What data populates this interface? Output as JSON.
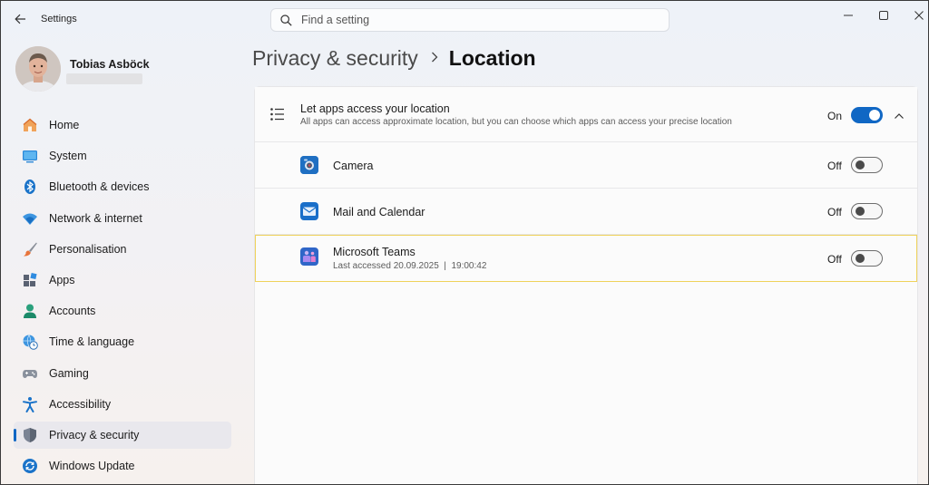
{
  "window": {
    "title": "Settings",
    "search_placeholder": "Find a setting"
  },
  "profile": {
    "name": "Tobias Asböck"
  },
  "nav": {
    "items": [
      {
        "label": "Home",
        "icon": "home-icon"
      },
      {
        "label": "System",
        "icon": "monitor-icon"
      },
      {
        "label": "Bluetooth & devices",
        "icon": "bluetooth-icon"
      },
      {
        "label": "Network & internet",
        "icon": "wifi-icon"
      },
      {
        "label": "Personalisation",
        "icon": "brush-icon"
      },
      {
        "label": "Apps",
        "icon": "apps-icon"
      },
      {
        "label": "Accounts",
        "icon": "person-icon"
      },
      {
        "label": "Time & language",
        "icon": "globe-clock-icon"
      },
      {
        "label": "Gaming",
        "icon": "gamepad-icon"
      },
      {
        "label": "Accessibility",
        "icon": "accessibility-icon"
      },
      {
        "label": "Privacy & security",
        "icon": "shield-icon",
        "active": true
      },
      {
        "label": "Windows Update",
        "icon": "update-icon"
      }
    ]
  },
  "breadcrumb": {
    "parent": "Privacy & security",
    "current": "Location"
  },
  "location": {
    "main": {
      "title": "Let apps access your location",
      "subtitle": "All apps can access approximate location, but you can choose which apps can access your precise location",
      "state": "On"
    },
    "apps": [
      {
        "name": "Camera",
        "state": "Off",
        "icon": "camera-icon"
      },
      {
        "name": "Mail and Calendar",
        "state": "Off",
        "icon": "mail-icon"
      },
      {
        "name": "Microsoft Teams",
        "state": "Off",
        "icon": "teams-icon",
        "last_accessed": "Last accessed 20.09.2025  |  19:00:42"
      }
    ]
  },
  "colors": {
    "accent": "#1067c4",
    "highlight_border": "#efd25b"
  }
}
